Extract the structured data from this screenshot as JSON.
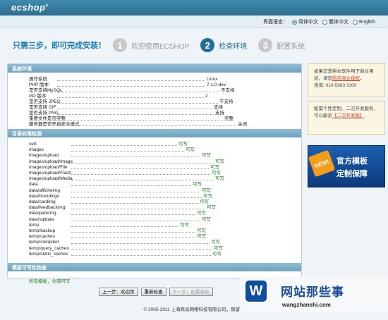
{
  "header": {
    "logo": "ecshop",
    "logo_mark": "®",
    "language_label": "界面语言：",
    "languages": [
      {
        "label": "简体中文",
        "selected": true
      },
      {
        "label": "繁体中文",
        "selected": false
      },
      {
        "label": "English",
        "selected": false
      }
    ]
  },
  "steps": {
    "headline": "只需三步，即可完成安装！",
    "items": [
      {
        "num": "1",
        "label": "欢迎使用ECSHOP",
        "active": false
      },
      {
        "num": "2",
        "label": "检查环境",
        "active": true
      },
      {
        "num": "3",
        "label": "配置系统",
        "active": false
      }
    ]
  },
  "system_env": {
    "title": "系统环境",
    "rows": [
      {
        "label": "操作系统",
        "value": "Linux"
      },
      {
        "label": "PHP 版本",
        "value": "7.1.0-dev"
      },
      {
        "label": "是否支持MySQL",
        "value": "不支持"
      },
      {
        "label": "GD 版本",
        "value": "2"
      },
      {
        "label": "是否支持 JPEG",
        "value": "不支持"
      },
      {
        "label": "是否支持 GIF",
        "value": "支持"
      },
      {
        "label": "是否支持 PNG",
        "value": "支持"
      },
      {
        "label": "重要文件是否完整",
        "value": "完整"
      },
      {
        "label": "服务器是否开启安全模式",
        "value": "关闭"
      }
    ]
  },
  "dir_perms": {
    "title": "目录权限检测",
    "rows": [
      {
        "label": "cert",
        "value": "可写"
      },
      {
        "label": "images",
        "value": "可写"
      },
      {
        "label": "images/upload",
        "value": "可写"
      },
      {
        "label": "images/upload/Image",
        "value": "可写"
      },
      {
        "label": "images/upload/File",
        "value": "可写"
      },
      {
        "label": "images/upload/Flash",
        "value": "可写"
      },
      {
        "label": "images/upload/Media",
        "value": "可写"
      },
      {
        "label": "data",
        "value": "可写"
      },
      {
        "label": "data/afficheimg",
        "value": "可写"
      },
      {
        "label": "data/brandlogo",
        "value": "可写"
      },
      {
        "label": "data/cardimg",
        "value": "可写"
      },
      {
        "label": "data/feedbackimg",
        "value": "可写"
      },
      {
        "label": "data/packimg",
        "value": "可写"
      },
      {
        "label": "data/sqldata",
        "value": "可写"
      },
      {
        "label": "temp",
        "value": "可写"
      },
      {
        "label": "temp/backup",
        "value": "可写"
      },
      {
        "label": "temp/caches",
        "value": "可写"
      },
      {
        "label": "temp/compiled",
        "value": "可写"
      },
      {
        "label": "temp/query_caches",
        "value": "可写"
      },
      {
        "label": "temp/static_caches",
        "value": "可写"
      }
    ]
  },
  "template_check": {
    "title": "模板可写性检查",
    "result": "所有模板，全部可写"
  },
  "buttons": {
    "prev": "上一步：欢迎页",
    "recheck": "重新检查",
    "next": "下一步：配置系统"
  },
  "footer": {
    "copyright": "© 2005-2011 上海商派网络科技有限公司，保留所"
  },
  "sidebar": {
    "box1_text1": "如果您想将本软件用于商业用途，请您",
    "box1_link": "购买商业授权",
    "box1_text2": "。",
    "box1_phone": "咨询: 010-5683 3100",
    "box2_text1": "如需个性定制、二次开发服务，可以联系",
    "box2_link": "【二次开发服】",
    "promo_badge": "NEW!",
    "promo_line1": "官方模板",
    "promo_line2": "定制保障"
  },
  "watermark": {
    "logo_letter": "W",
    "title": "网站那些事",
    "url": "wangzhanshi.com"
  }
}
